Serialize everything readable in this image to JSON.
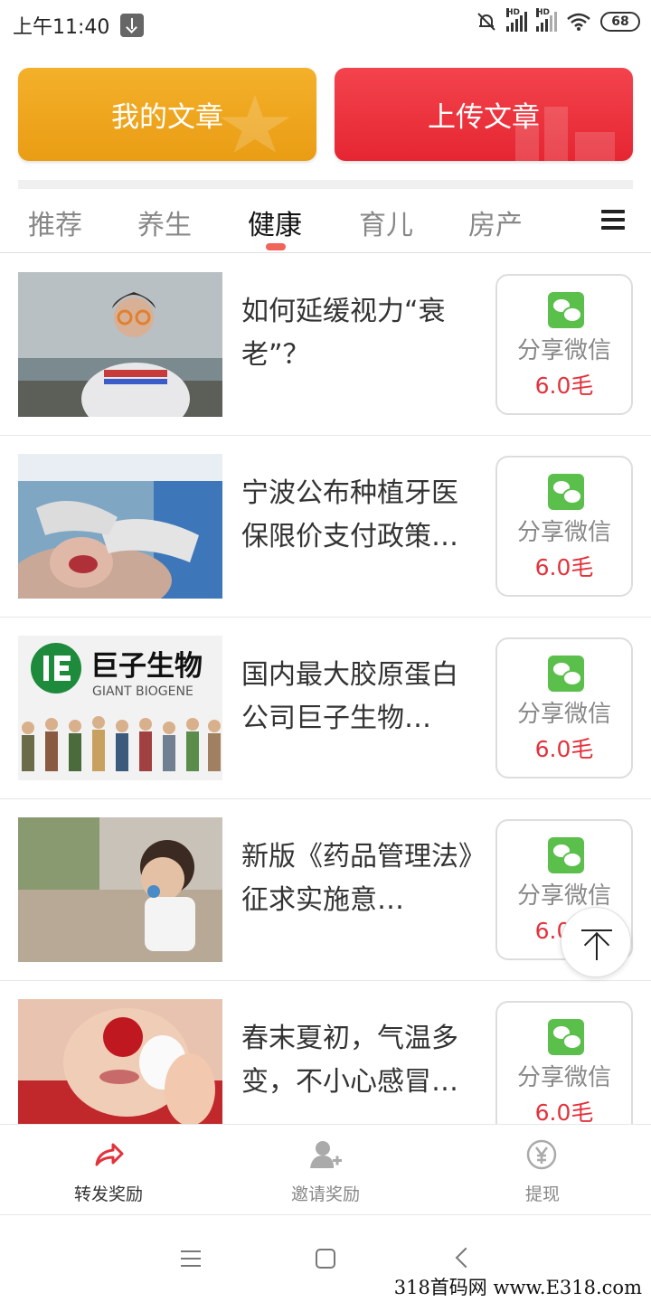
{
  "status_bar": {
    "time": "上午11:40",
    "battery": "68",
    "signal_tag": "HD"
  },
  "top_buttons": {
    "my_articles": "我的文章",
    "upload_article": "上传文章"
  },
  "tabs": [
    {
      "label": "推荐",
      "active": false
    },
    {
      "label": "养生",
      "active": false
    },
    {
      "label": "健康",
      "active": true
    },
    {
      "label": "育儿",
      "active": false
    },
    {
      "label": "房产",
      "active": false
    }
  ],
  "articles": [
    {
      "title": "如何延缓视力“衰老”？",
      "share_label": "分享微信",
      "reward": "6.0毛"
    },
    {
      "title": "宁波公布种植牙医保限价支付政策…",
      "share_label": "分享微信",
      "reward": "6.0毛"
    },
    {
      "title": "国内最大胶原蛋白公司巨子生物…",
      "share_label": "分享微信",
      "reward": "6.0毛",
      "image_text": {
        "brand_cn": "巨子生物",
        "brand_en": "GIANT BIOGENE"
      }
    },
    {
      "title": "新版《药品管理法》征求实施意…",
      "share_label": "分享微信",
      "reward": "6.0毛"
    },
    {
      "title": "春末夏初，气温多变，不小心感冒…",
      "share_label": "分享微信",
      "reward": "6.0毛"
    }
  ],
  "bottom_nav": [
    {
      "label": "转发奖励",
      "icon": "share-arrow-icon",
      "active": true
    },
    {
      "label": "邀请奖励",
      "icon": "add-user-icon",
      "active": false
    },
    {
      "label": "提现",
      "icon": "yuan-coin-icon",
      "active": false
    }
  ],
  "watermark": "318首码网 www.E318.com",
  "colors": {
    "accent_red": "#e2333c",
    "orange": "#f4b02a",
    "wechat_green": "#5bbf4b"
  }
}
